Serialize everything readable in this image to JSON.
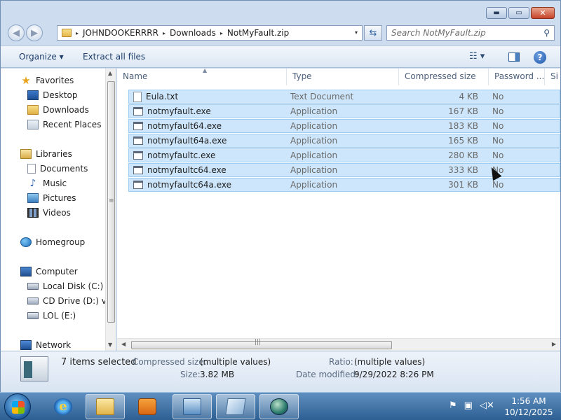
{
  "window": {
    "minimize_glyph": "▬",
    "maximize_glyph": "▭",
    "close_glyph": "✕"
  },
  "address": {
    "segments": [
      "JOHNDOOKERRRR",
      "Downloads",
      "NotMyFault.zip"
    ],
    "separator": "▸",
    "dropdown": "▾"
  },
  "search": {
    "placeholder": "Search NotMyFault.zip"
  },
  "toolbar": {
    "organize": "Organize ▾",
    "extract": "Extract all files",
    "views": "☷ ▾",
    "help": "?"
  },
  "nav": {
    "favorites": {
      "label": "Favorites",
      "items": [
        "Desktop",
        "Downloads",
        "Recent Places"
      ]
    },
    "libraries": {
      "label": "Libraries",
      "items": [
        "Documents",
        "Music",
        "Pictures",
        "Videos"
      ]
    },
    "homegroup": "Homegroup",
    "computer": {
      "label": "Computer",
      "items": [
        "Local Disk (C:)",
        "CD Drive (D:) virt",
        "LOL (E:)"
      ]
    },
    "network": "Network"
  },
  "columns": [
    "Name",
    "Type",
    "Compressed size",
    "Password ...",
    "Si"
  ],
  "files": [
    {
      "name": "Eula.txt",
      "type": "Text Document",
      "size": "4 KB",
      "password": "No",
      "icon": "text-file-icon"
    },
    {
      "name": "notmyfault.exe",
      "type": "Application",
      "size": "167 KB",
      "password": "No",
      "icon": "exe-icon"
    },
    {
      "name": "notmyfault64.exe",
      "type": "Application",
      "size": "183 KB",
      "password": "No",
      "icon": "exe-icon"
    },
    {
      "name": "notmyfault64a.exe",
      "type": "Application",
      "size": "165 KB",
      "password": "No",
      "icon": "exe-icon"
    },
    {
      "name": "notmyfaultc.exe",
      "type": "Application",
      "size": "280 KB",
      "password": "No",
      "icon": "exe-icon"
    },
    {
      "name": "notmyfaultc64.exe",
      "type": "Application",
      "size": "333 KB",
      "password": "No",
      "icon": "exe-icon"
    },
    {
      "name": "notmyfaultc64a.exe",
      "type": "Application",
      "size": "301 KB",
      "password": "No",
      "icon": "exe-icon"
    }
  ],
  "details": {
    "selected": "7 items selected",
    "compressed_label": "Compressed size:",
    "compressed_value": "(multiple values)",
    "size_label": "Size:",
    "size_value": "3.82 MB",
    "ratio_label": "Ratio:",
    "ratio_value": "(multiple values)",
    "modified_label": "Date modified:",
    "modified_value": "9/29/2022 8:26 PM"
  },
  "taskbar": {
    "time": "1:56 AM",
    "date": "10/12/2025",
    "ie_glyph": "e"
  },
  "colors": {
    "selection": "#cde6fb",
    "selection_border": "#9fcdf2",
    "taskbar": "#2d5f93"
  }
}
